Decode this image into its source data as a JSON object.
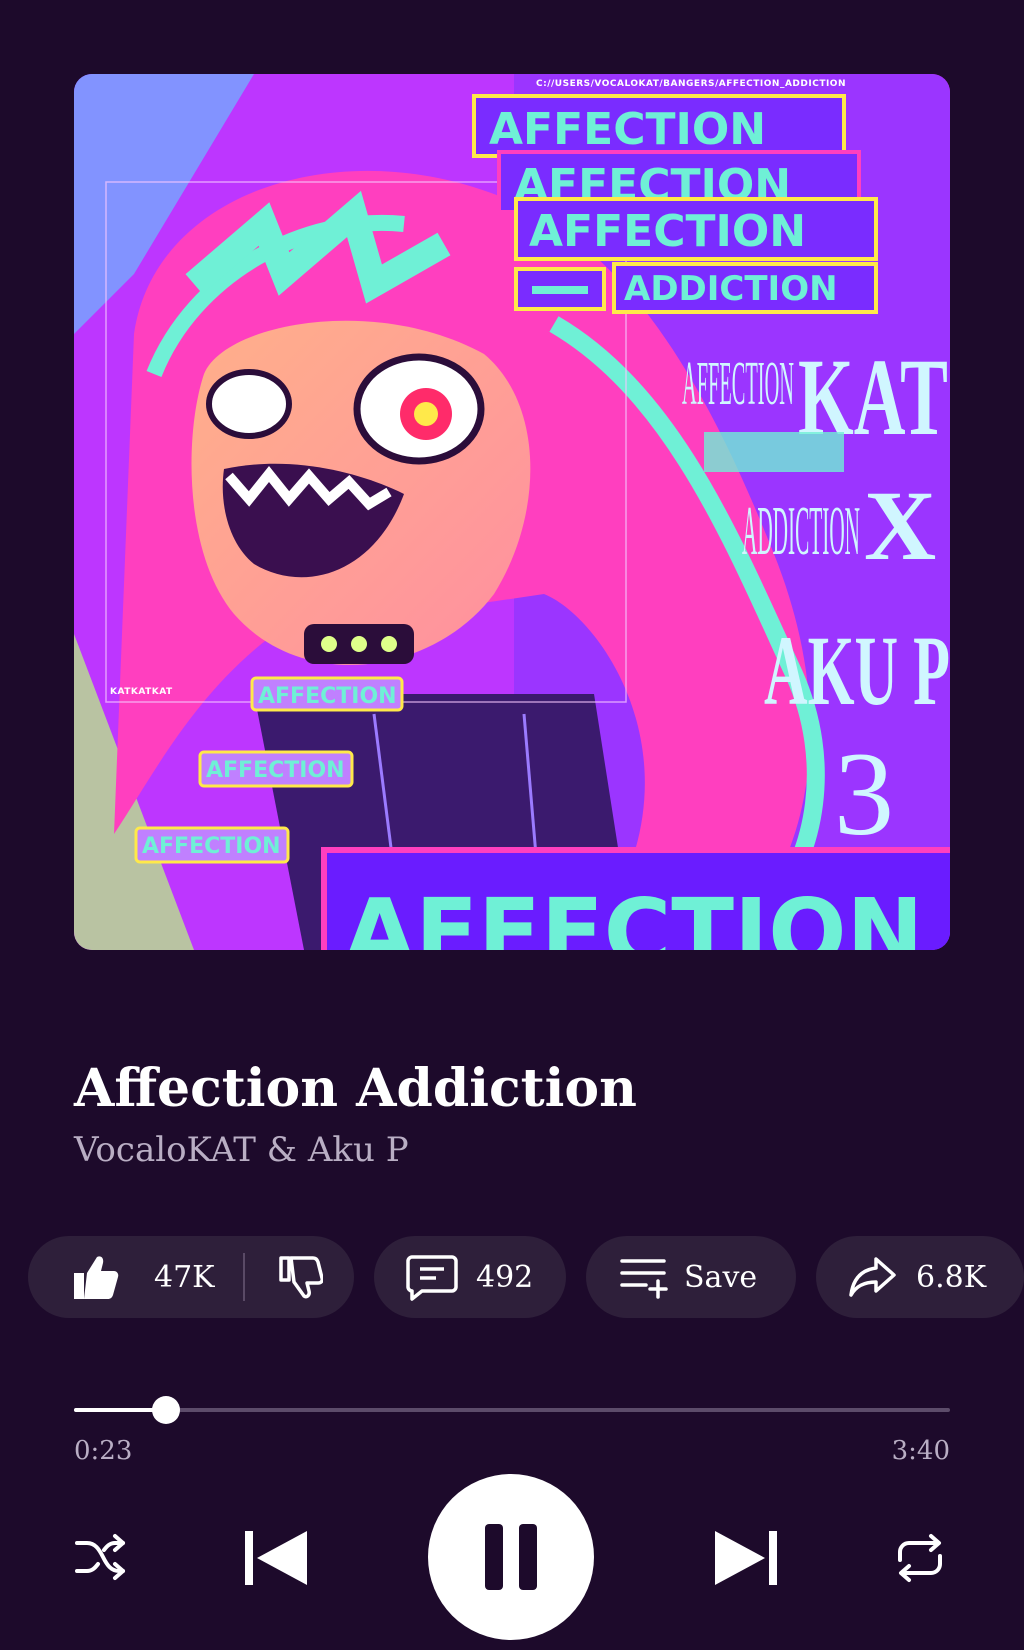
{
  "artwork": {
    "description_icon": "album-art-image",
    "path_text": "C://USERS/VOCALOKAT/BANGERS/AFFECTION_ADDICTION",
    "banner_1": "AFFECTION",
    "banner_2": "AFFECTION",
    "banner_3": "AFFECTION",
    "banner_4": "ADDICTION",
    "side_1": "AFFECTION",
    "side_2": "KAT",
    "side_3": "ADDICTION",
    "side_4": "X",
    "side_5": "AKU P",
    "side_6": "3",
    "tag_1": "AFFECTION",
    "tag_2": "AFFECTION",
    "tag_3": "AFFECTION",
    "strip": "KATKATKAT",
    "bottom": "AFFECTION"
  },
  "song": {
    "title": "Affection Addiction",
    "artist": "VocaloKAT & Aku P"
  },
  "actions": {
    "like_count": "47K",
    "comment_count": "492",
    "save_label": "Save",
    "share_count": "6.8K"
  },
  "player": {
    "elapsed": "0:23",
    "duration": "3:40",
    "progress_fraction": 0.1045
  },
  "colors": {
    "background": "#1d0a2b",
    "pill": "#2e1f3a",
    "accent_teal": "#6ff0d6",
    "accent_pink": "#ff3fbf"
  },
  "icons": [
    "thumbs-up-icon",
    "thumbs-down-icon",
    "comment-icon",
    "playlist-add-icon",
    "share-icon",
    "shuffle-icon",
    "previous-icon",
    "pause-icon",
    "next-icon",
    "repeat-icon"
  ]
}
